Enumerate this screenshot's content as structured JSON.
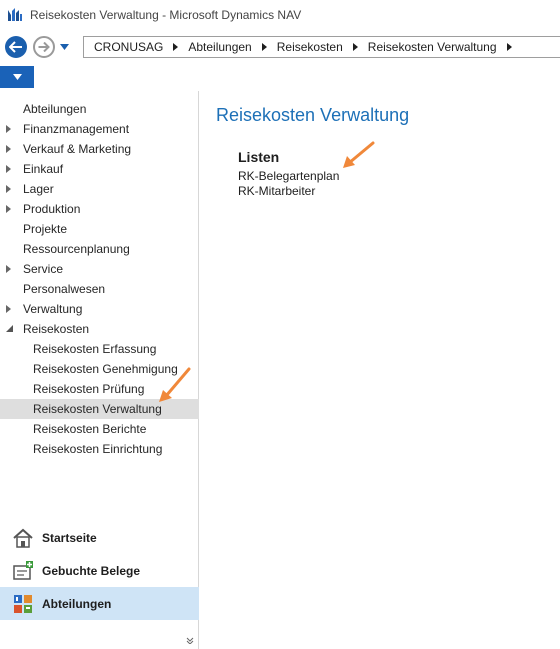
{
  "window": {
    "title": "Reisekosten Verwaltung - Microsoft Dynamics NAV"
  },
  "breadcrumb": [
    "CRONUSAG",
    "Abteilungen",
    "Reisekosten",
    "Reisekosten Verwaltung"
  ],
  "sidebar": {
    "items": [
      {
        "label": "Abteilungen",
        "expander": "none"
      },
      {
        "label": "Finanzmanagement",
        "expander": "collapsed"
      },
      {
        "label": "Verkauf & Marketing",
        "expander": "collapsed"
      },
      {
        "label": "Einkauf",
        "expander": "collapsed"
      },
      {
        "label": "Lager",
        "expander": "collapsed"
      },
      {
        "label": "Produktion",
        "expander": "collapsed"
      },
      {
        "label": "Projekte",
        "expander": "none"
      },
      {
        "label": "Ressourcenplanung",
        "expander": "none"
      },
      {
        "label": "Service",
        "expander": "collapsed"
      },
      {
        "label": "Personalwesen",
        "expander": "none"
      },
      {
        "label": "Verwaltung",
        "expander": "collapsed"
      },
      {
        "label": "Reisekosten",
        "expander": "expanded"
      }
    ],
    "subitems": [
      {
        "label": "Reisekosten Erfassung",
        "selected": false
      },
      {
        "label": "Reisekosten Genehmigung",
        "selected": false
      },
      {
        "label": "Reisekosten Prüfung",
        "selected": false
      },
      {
        "label": "Reisekosten Verwaltung",
        "selected": true
      },
      {
        "label": "Reisekosten Berichte",
        "selected": false
      },
      {
        "label": "Reisekosten Einrichtung",
        "selected": false
      }
    ],
    "bottom": [
      {
        "label": "Startseite",
        "icon": "home-icon",
        "active": false
      },
      {
        "label": "Gebuchte Belege",
        "icon": "posted-documents-icon",
        "active": false
      },
      {
        "label": "Abteilungen",
        "icon": "departments-icon",
        "active": true
      }
    ]
  },
  "main": {
    "title": "Reisekosten Verwaltung",
    "group": "Listen",
    "links": [
      "RK-Belegartenplan",
      "RK-Mitarbeiter"
    ]
  },
  "colors": {
    "accent": "#1d70b7",
    "ribbon_button": "#1a62b8",
    "annotation_arrow": "#f0883a",
    "selected_row": "#dedede",
    "active_bottom": "#cfe4f6"
  }
}
